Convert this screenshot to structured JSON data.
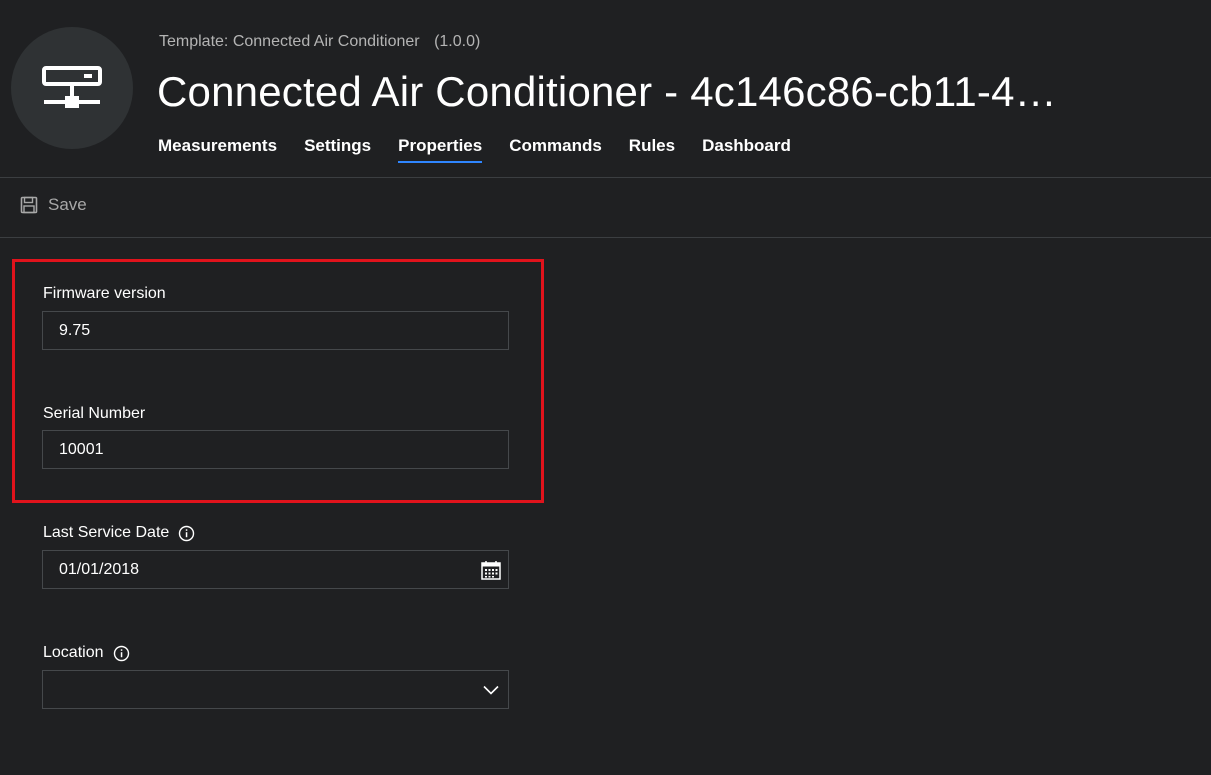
{
  "header": {
    "template_prefix": "Template:",
    "template_name": "Connected Air Conditioner",
    "template_version": "(1.0.0)",
    "device_title": "Connected Air Conditioner - 4c146c86-cb11-4…",
    "avatar_icon": "network-device-icon"
  },
  "tabs": [
    {
      "label": "Measurements",
      "active": false
    },
    {
      "label": "Settings",
      "active": false
    },
    {
      "label": "Properties",
      "active": true
    },
    {
      "label": "Commands",
      "active": false
    },
    {
      "label": "Rules",
      "active": false
    },
    {
      "label": "Dashboard",
      "active": false
    }
  ],
  "toolbar": {
    "save_label": "Save",
    "save_icon": "floppy-disk-icon"
  },
  "fields": {
    "firmware": {
      "label": "Firmware version",
      "value": "9.75"
    },
    "serial": {
      "label": "Serial Number",
      "value": "10001"
    },
    "service_date": {
      "label": "Last Service Date",
      "value": "01/01/2018",
      "info_icon": "info-icon",
      "trail_icon": "calendar-icon"
    },
    "location": {
      "label": "Location",
      "value": "",
      "info_icon": "info-icon",
      "trail_icon": "chevron-down-icon"
    }
  },
  "colors": {
    "background": "#1f2022",
    "accent": "#2f86ff",
    "highlight": "#e0131c",
    "muted_text": "#b4b4b4"
  }
}
